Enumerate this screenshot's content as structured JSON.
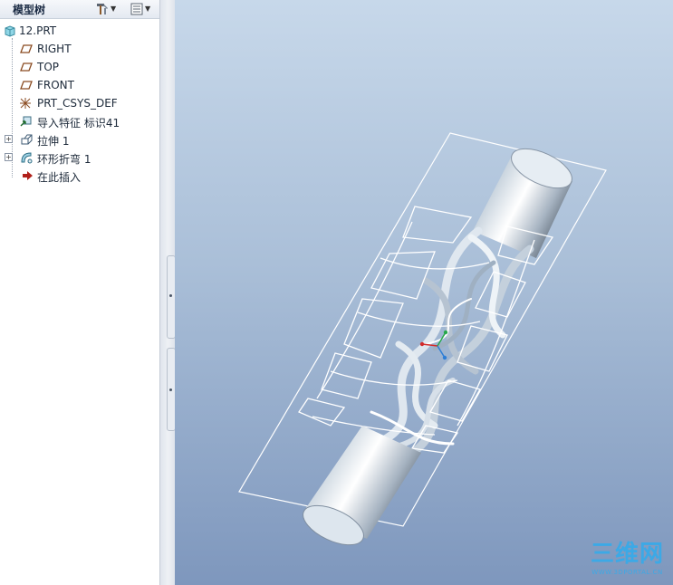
{
  "tree": {
    "title": "模型树",
    "items": [
      {
        "label": "12.PRT",
        "icon": "part-icon"
      },
      {
        "label": "RIGHT",
        "icon": "datum-plane-icon"
      },
      {
        "label": "TOP",
        "icon": "datum-plane-icon"
      },
      {
        "label": "FRONT",
        "icon": "datum-plane-icon"
      },
      {
        "label": "PRT_CSYS_DEF",
        "icon": "csys-icon"
      },
      {
        "label": "导入特征 标识41",
        "icon": "import-feature-icon"
      },
      {
        "label": "拉伸 1",
        "icon": "extrude-icon"
      },
      {
        "label": "环形折弯 1",
        "icon": "toroidal-bend-icon"
      },
      {
        "label": "在此插入",
        "icon": "insert-here-arrow-icon"
      }
    ]
  },
  "colors": {
    "viewport_top": "#c7d8ea",
    "viewport_bottom": "#7e97bd",
    "insert_arrow": "#b0201a",
    "watermark": "#3ca9e6"
  },
  "watermark": {
    "main": "三维网",
    "sub": "WWW.3DPORTAL.CN"
  }
}
